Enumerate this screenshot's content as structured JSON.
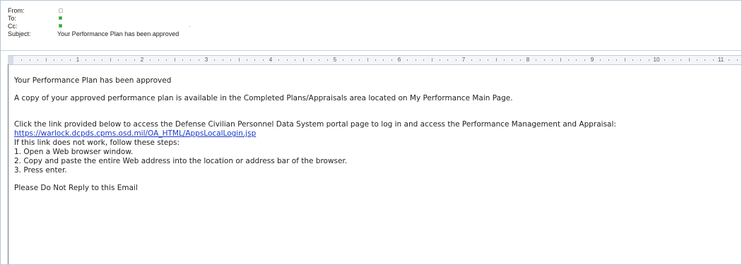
{
  "header": {
    "from_label": "From:",
    "to_label": "To:",
    "cc_label": "Cc:",
    "subject_label": "Subject:",
    "subject_value": "Your Performance Plan has been approved",
    "cc_extra": "."
  },
  "ruler": {
    "numbers": [
      "1",
      "2",
      "3",
      "4",
      "5",
      "6",
      "7",
      "8",
      "9",
      "10",
      "11"
    ]
  },
  "body": {
    "heading": "Your Performance Plan has been approved",
    "para1": "A copy of your approved performance plan is available in the Completed Plans/Appraisals area located on My Performance Main Page.",
    "para2": "Click the link provided below to access the Defense Civilian Personnel Data System portal page to log in and access the Performance Management and Appraisal:",
    "link": "https://warlock.dcpds.cpms.osd.mil/OA_HTML/AppsLocalLogin.jsp",
    "instr_intro": "If this link does not work, follow these steps:",
    "step1": "1. Open a Web browser window.",
    "step2": "2. Copy and paste the entire Web address into the location or address bar of the browser.",
    "step3": "3. Press enter.",
    "closing": "Please Do Not Reply to this Email"
  },
  "colors": {
    "link": "#1a3acb",
    "status_green": "#2fa83c",
    "ruler_bg": "#f3f5f8"
  }
}
